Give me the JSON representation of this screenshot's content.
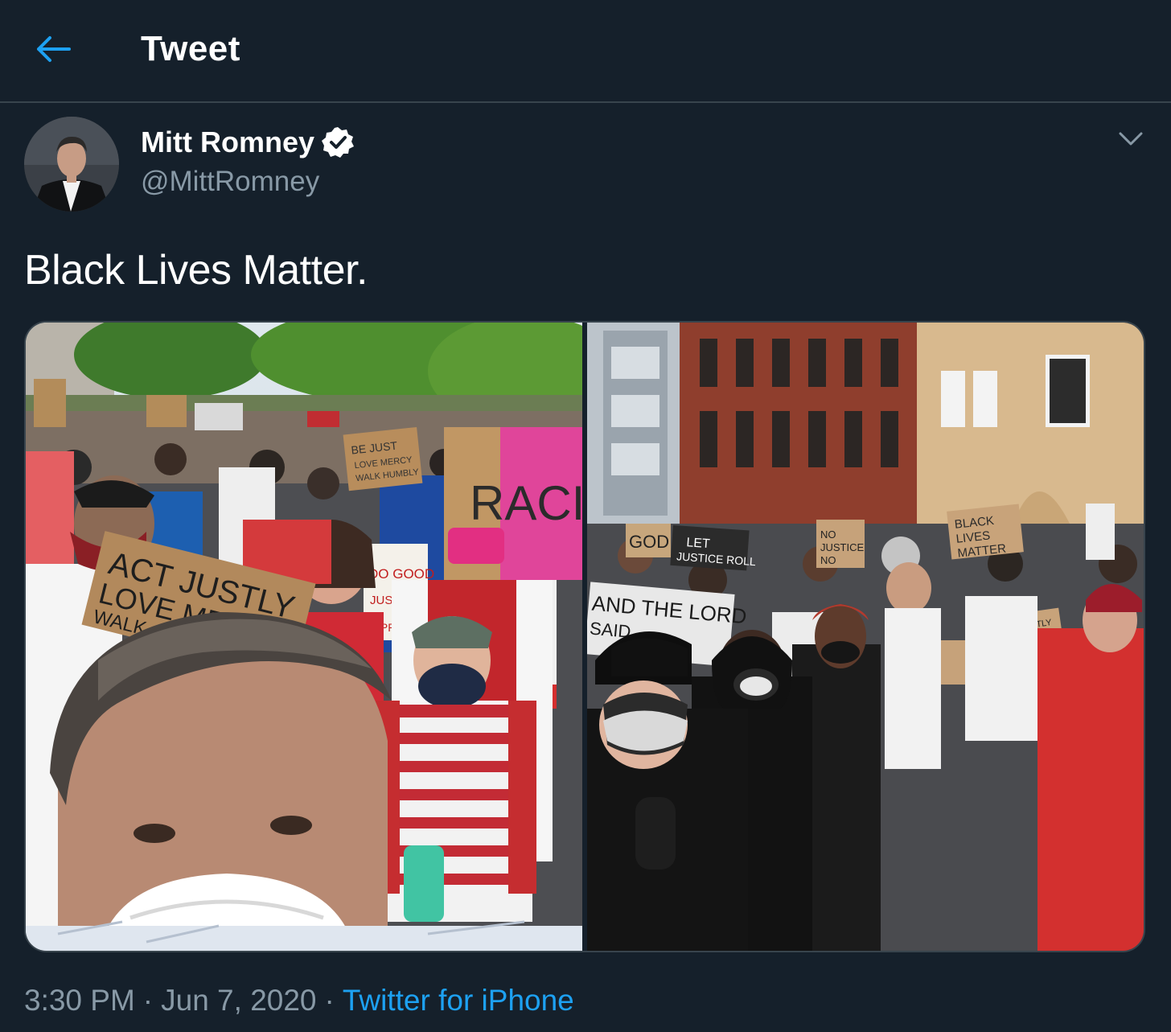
{
  "header": {
    "title": "Tweet",
    "back_icon": "arrow-left-icon"
  },
  "colors": {
    "background": "#15202b",
    "accent": "#1da1f2",
    "secondary_text": "#8899a6",
    "divider": "#38444d",
    "primary_text": "#ffffff"
  },
  "tweet": {
    "author": {
      "display_name": "Mitt Romney",
      "handle": "@MittRomney",
      "verified": true,
      "verified_icon": "verified-badge-icon"
    },
    "text": "Black Lives Matter.",
    "menu_icon": "chevron-down-icon",
    "media": [
      {
        "kind": "photo",
        "signs": [
          "ACT JUSTLY LOVE MERCY WALK",
          "RACISM",
          "DO GOOD SEEK JUSTICE CORRECT OPPRESSION",
          "BE JUST LOVE MERCY WALK HUMBLY"
        ]
      },
      {
        "kind": "photo",
        "signs": [
          "GOD",
          "LET JUSTICE ROLL",
          "NO JUSTICE NO",
          "BLACK LIVES MATTER",
          "AND THE LORD SAID",
          "ACT JUSTLY LOVE MERCY WALK HUMBLY"
        ]
      }
    ],
    "time": "3:30 PM",
    "date": "Jun 7, 2020",
    "separator": "·",
    "source": "Twitter for iPhone"
  }
}
